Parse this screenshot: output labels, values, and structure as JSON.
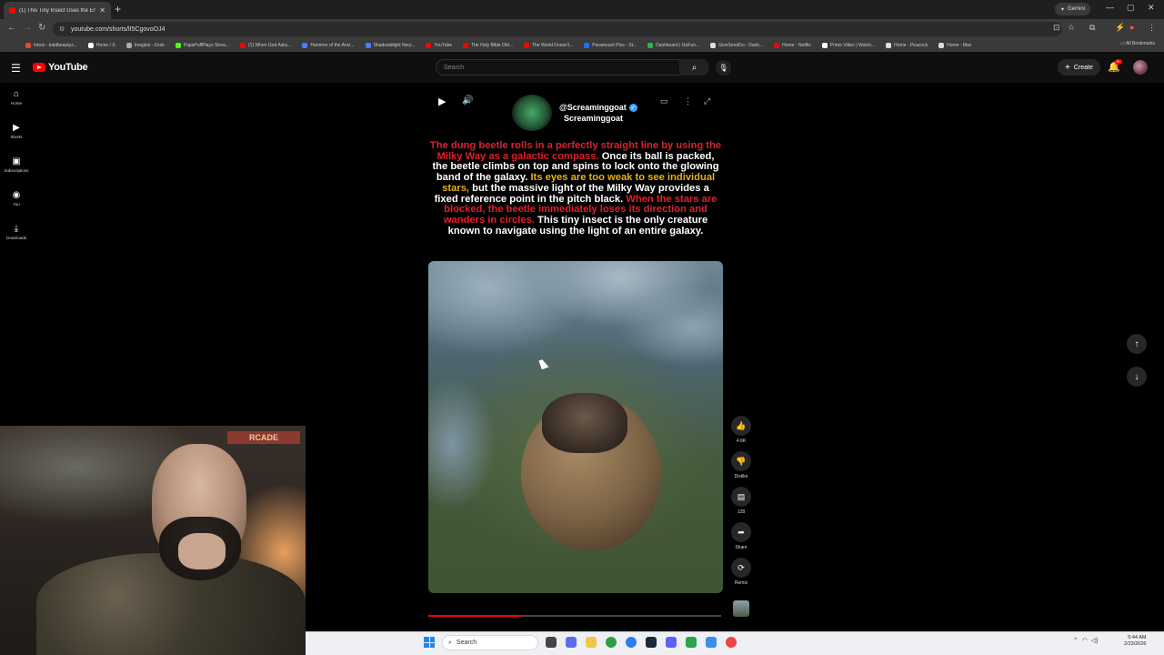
{
  "browser": {
    "tab_title": "(1) This Tiny Insect Uses the En",
    "url": "youtube.com/shorts/lI5CgovoOJ4",
    "gemini_label": "Gemini",
    "all_bookmarks": "All Bookmarks",
    "bookmarks": [
      {
        "label": "Inbox - baldbeautyz...",
        "color": "#e14b3b"
      },
      {
        "label": "Home / X",
        "color": "#ffffff"
      },
      {
        "label": "Imagine - Grok",
        "color": "#aaaaaa"
      },
      {
        "label": "PapaPuffPlays Strea...",
        "color": "#53fc18"
      },
      {
        "label": "(1) When God Asks...",
        "color": "#ff0000"
      },
      {
        "label": "Hammer of the Anci...",
        "color": "#4a7cff"
      },
      {
        "label": "Shadowblight Necr...",
        "color": "#4a7cff"
      },
      {
        "label": "YouTube",
        "color": "#ff0000"
      },
      {
        "label": "The Holy Bible Old...",
        "color": "#ff0000"
      },
      {
        "label": "The World Doesn't...",
        "color": "#ff0000"
      },
      {
        "label": "Paramount Plus - St...",
        "color": "#1f6fff"
      },
      {
        "label": "Dashboard | GoFun...",
        "color": "#2fb24c"
      },
      {
        "label": "GiveSendGo - Dash...",
        "color": "#dddddd"
      },
      {
        "label": "Home - Netflix",
        "color": "#e50914"
      },
      {
        "label": "Prime Video | Watch...",
        "color": "#ffffff"
      },
      {
        "label": "Home - Peacock",
        "color": "#dddddd"
      },
      {
        "label": "Home - Max",
        "color": "#dddddd"
      }
    ]
  },
  "youtube": {
    "logo_text": "YouTube",
    "search_placeholder": "Search",
    "create_label": "Create",
    "notif_count": "9+",
    "nav": [
      {
        "label": "Home",
        "icon": "home-icon",
        "glyph": "⌂"
      },
      {
        "label": "Shorts",
        "icon": "shorts-icon",
        "glyph": "▶"
      },
      {
        "label": "Subscriptions",
        "icon": "subscriptions-icon",
        "glyph": "▣"
      },
      {
        "label": "You",
        "icon": "you-icon",
        "glyph": "◉"
      },
      {
        "label": "Downloads",
        "icon": "downloads-icon",
        "glyph": "⤓"
      }
    ]
  },
  "short": {
    "handle": "@Screaminggoat",
    "channel_name": "Screaminggoat",
    "caption": [
      {
        "text": "The dung beetle rolls in a perfectly straight line by using the Milky Way as a galactic compass.",
        "color": "red"
      },
      {
        "text": " Once its ball is packed, the beetle climbs on top and spins to lock onto the glowing band of the galaxy.",
        "color": "white"
      },
      {
        "text": " Its eyes are too weak to see individual stars,",
        "color": "yellow"
      },
      {
        "text": " but the massive light of the Milky Way provides a fixed reference point in the pitch black.",
        "color": "white"
      },
      {
        "text": " When the stars are blocked, the beetle immediately loses its direction and wanders in circles.",
        "color": "red"
      },
      {
        "text": " This tiny insect is the only creature known to navigate using the light of an entire galaxy.",
        "color": "white"
      }
    ],
    "progress": 0.32,
    "actions": {
      "like_count": "4.6K",
      "dislike_label": "Dislike",
      "comment_count": "128",
      "share_label": "Share",
      "remix_label": "Remix"
    }
  },
  "webcam": {
    "poster_text": "RCADE"
  },
  "taskbar": {
    "search_label": "Search",
    "time": "5:44 AM",
    "date": "2/23/2026"
  }
}
